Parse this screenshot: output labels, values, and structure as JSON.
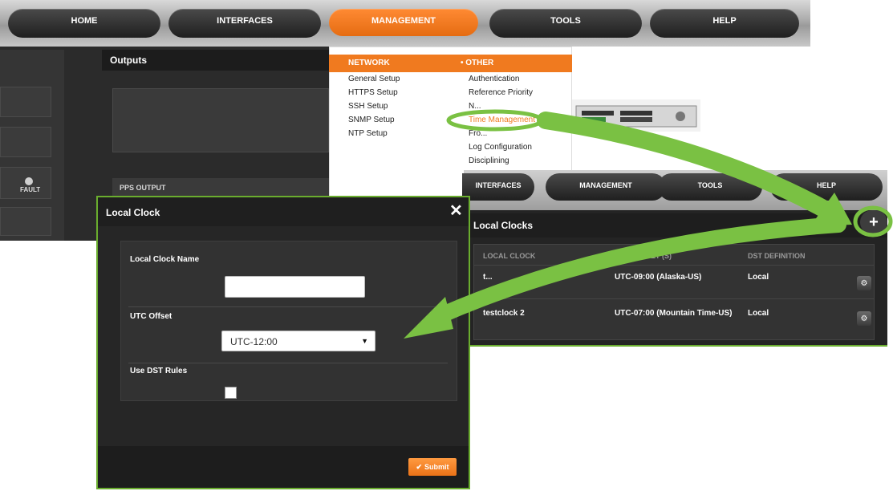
{
  "topnav": {
    "items": [
      "HOME",
      "INTERFACES",
      "MANAGEMENT",
      "TOOLS",
      "HELP"
    ],
    "active": "MANAGEMENT"
  },
  "outputs": {
    "title": "Outputs",
    "fault_label": "FAULT",
    "pps_output": "PPS OUTPUT"
  },
  "management_menu": {
    "network_header": "NETWORK",
    "other_header": "• OTHER",
    "network_items": [
      "General Setup",
      "HTTPS Setup",
      "SSH Setup",
      "SNMP Setup",
      "NTP Setup"
    ],
    "other_items": [
      "Authentication",
      "Reference Priority",
      "N...",
      "Time Management",
      "Fro...",
      "Log Configuration",
      "Disciplining"
    ],
    "highlighted": "Time Management"
  },
  "local_clocks": {
    "nav": [
      "INTERFACES",
      "MANAGEMENT",
      "TOOLS",
      "HELP"
    ],
    "title": "Local Clocks",
    "add_symbol": "+",
    "columns": [
      "LOCAL CLOCK",
      "UTC OFFSET (S)",
      "DST DEFINITION"
    ],
    "rows": [
      {
        "name": "t...",
        "offset": "UTC-09:00 (Alaska-US)",
        "dst": "Local"
      },
      {
        "name": "testclock 2",
        "offset": "UTC-07:00 (Mountain Time-US)",
        "dst": "Local"
      }
    ]
  },
  "dialog": {
    "title": "Local Clock",
    "close_symbol": "✕",
    "name_label": "Local Clock Name",
    "name_value": "",
    "utc_label": "UTC Offset",
    "utc_value": "UTC-12:00",
    "dst_label": "Use DST Rules",
    "dst_checked": false,
    "submit_label": "Submit"
  },
  "colors": {
    "accent_orange": "#f07a1f",
    "annotation_green": "#6aad2e",
    "dark_panel": "#262626"
  }
}
